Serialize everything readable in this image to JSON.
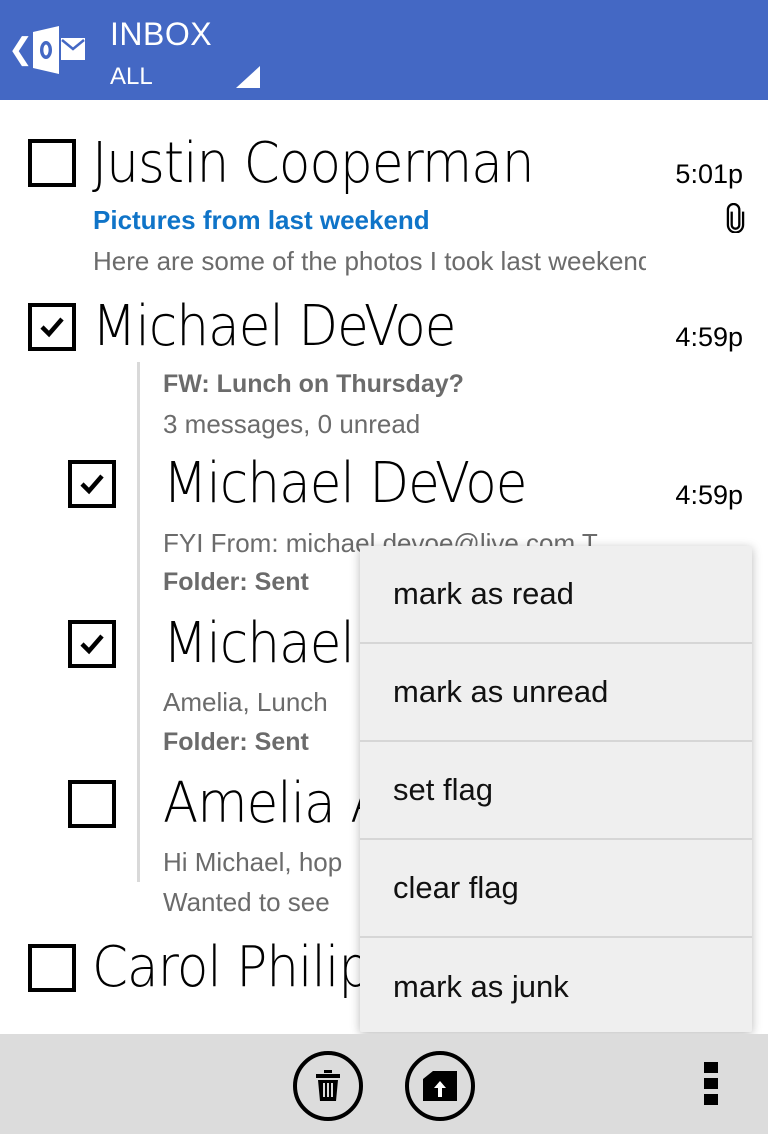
{
  "header": {
    "title": "INBOX",
    "filter": "ALL",
    "back_icon": "chevron-left-icon",
    "logo_icon": "outlook-logo-icon",
    "dropdown_icon": "dropdown-triangle-icon",
    "background_color": "#4468c4"
  },
  "messages": [
    {
      "sender": "Justin Cooperman",
      "time": "5:01p",
      "subject": "Pictures from last weekend",
      "preview": "Here are some of the photos I took last weekend",
      "checked": false,
      "has_attachment": true,
      "subject_color": "#0f74c8"
    },
    {
      "sender": "Michael DeVoe",
      "time": "4:59p",
      "checked": true,
      "thread": {
        "subject": "FW: Lunch on Thursday?",
        "summary": "3 messages, 0 unread",
        "items": [
          {
            "sender": "Michael DeVoe",
            "time": "4:59p",
            "preview": "FYI From: michael.devoe@live.com T",
            "folder": "Folder: Sent",
            "checked": true
          },
          {
            "sender": "Michael DeVoe",
            "preview": "Amelia,  Lunch",
            "folder": "Folder: Sent",
            "checked": true
          },
          {
            "sender": "Amelia A",
            "preview_line1": "Hi Michael, hop",
            "preview_line2": "Wanted to see",
            "checked": false
          }
        ]
      }
    },
    {
      "sender": "Carol Philips",
      "checked": false
    }
  ],
  "context_menu": {
    "items": [
      {
        "label": "mark as read"
      },
      {
        "label": "mark as unread"
      },
      {
        "label": "set flag"
      },
      {
        "label": "clear flag"
      },
      {
        "label": "mark as junk"
      }
    ]
  },
  "app_bar": {
    "delete_icon": "trash-icon",
    "move_icon": "folder-move-icon",
    "more_icon": "more-dots-icon",
    "background_color": "#dcdcdc"
  }
}
